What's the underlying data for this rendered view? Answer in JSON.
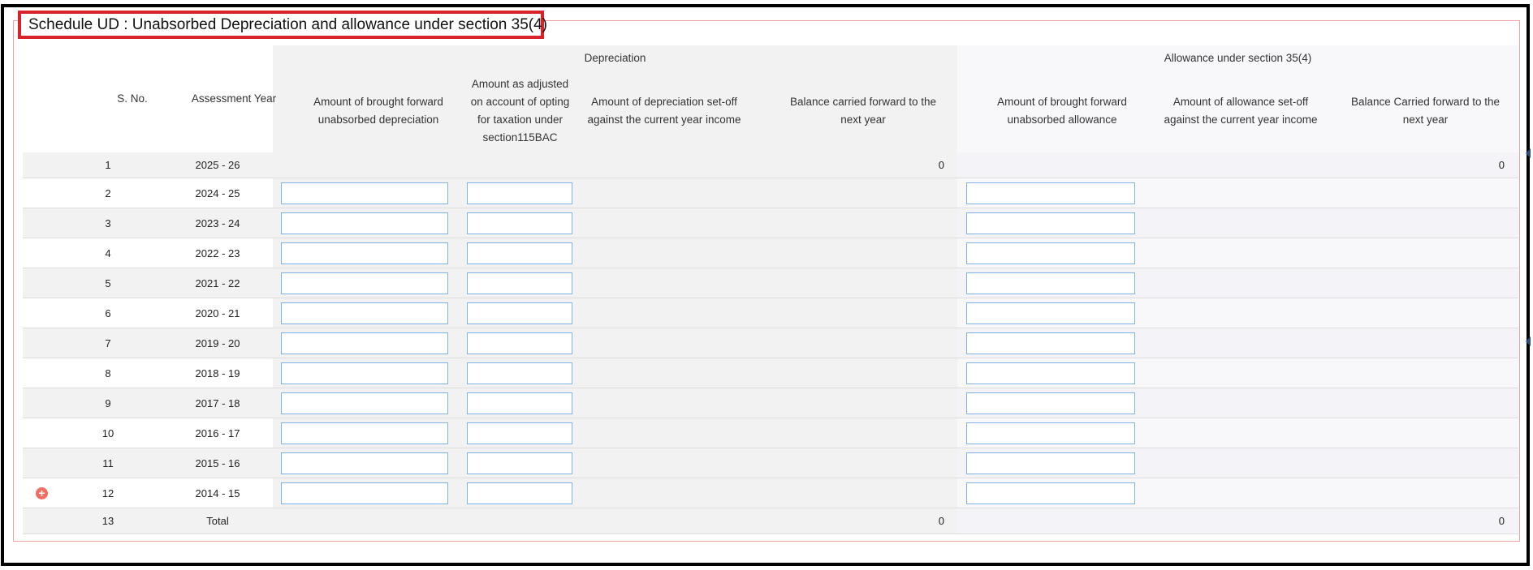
{
  "schedule_title": "Schedule UD : Unabsorbed Depreciation and allowance under section 35(4)",
  "headers": {
    "sno": "S. No.",
    "assessment_year": "Assessment Year",
    "depreciation_group": "Depreciation",
    "allowance_group": "Allowance under section 35(4)",
    "dep_bf": "Amount of brought forward unabsorbed depreciation",
    "dep_adjusted": "Amount as adjusted on account of opting for taxation under section115BAC",
    "dep_setoff": "Amount of depreciation set-off against the current year income",
    "dep_balance": "Balance carried forward to the next year",
    "alw_bf": "Amount of brought forward unabsorbed allowance",
    "alw_setoff": "Amount of allowance set-off against the current year income",
    "alw_balance": "Balance Carried forward to the next year"
  },
  "rows": [
    {
      "sno": "1",
      "ay": "2025 - 26",
      "dep_balance": "0",
      "alw_balance": "0",
      "inputs": false
    },
    {
      "sno": "2",
      "ay": "2024 - 25",
      "inputs": true
    },
    {
      "sno": "3",
      "ay": "2023 - 24",
      "inputs": true
    },
    {
      "sno": "4",
      "ay": "2022 - 23",
      "inputs": true
    },
    {
      "sno": "5",
      "ay": "2021 - 22",
      "inputs": true
    },
    {
      "sno": "6",
      "ay": "2020 - 21",
      "inputs": true
    },
    {
      "sno": "7",
      "ay": "2019 - 20",
      "inputs": true
    },
    {
      "sno": "8",
      "ay": "2018 - 19",
      "inputs": true
    },
    {
      "sno": "9",
      "ay": "2017 - 18",
      "inputs": true
    },
    {
      "sno": "10",
      "ay": "2016 - 17",
      "inputs": true
    },
    {
      "sno": "11",
      "ay": "2015 - 16",
      "inputs": true
    },
    {
      "sno": "12",
      "ay": "2014 - 15",
      "inputs": true
    },
    {
      "sno": "13",
      "ay": "Total",
      "dep_balance": "0",
      "alw_balance": "0",
      "inputs": false
    }
  ],
  "icons": {
    "add_row": "plus-circle-icon"
  },
  "colors": {
    "legend_border": "#d8232a",
    "input_border": "#7fb2e5",
    "add_icon": "#f26c62"
  }
}
